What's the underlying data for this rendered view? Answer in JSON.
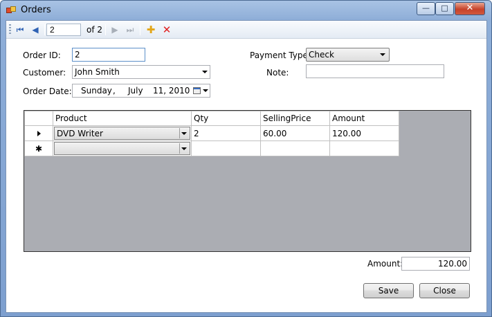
{
  "window": {
    "title": "Orders",
    "min_glyph": "—",
    "max_glyph": "□",
    "close_glyph": "✕"
  },
  "navigator": {
    "first_icon": "⏮",
    "prev_icon": "◀",
    "next_icon": "▶",
    "last_icon": "⏭",
    "position": "2",
    "count_text": "of 2",
    "add_icon": "✚",
    "delete_icon": "✕"
  },
  "form": {
    "order_id_label": "Order ID:",
    "order_id": "2",
    "customer_label": "Customer:",
    "customer": "John Smith",
    "order_date_label": "Order Date:",
    "order_date": {
      "weekday": "Sunday",
      "comma": ",",
      "month": "July",
      "day_year": "11, 2010"
    },
    "payment_type_label": "Payment Type:",
    "payment_type": "Check",
    "note_label": "Note:",
    "note": ""
  },
  "grid": {
    "columns": [
      "Product",
      "Qty",
      "SellingPrice",
      "Amount"
    ],
    "rows": [
      {
        "product": "DVD Writer",
        "qty": "2",
        "selling_price": "60.00",
        "amount": "120.00"
      }
    ],
    "new_row_marker": "✱"
  },
  "totals": {
    "amount_label": "Amount:",
    "amount": "120.00"
  },
  "buttons": {
    "save": "Save",
    "close": "Close"
  }
}
